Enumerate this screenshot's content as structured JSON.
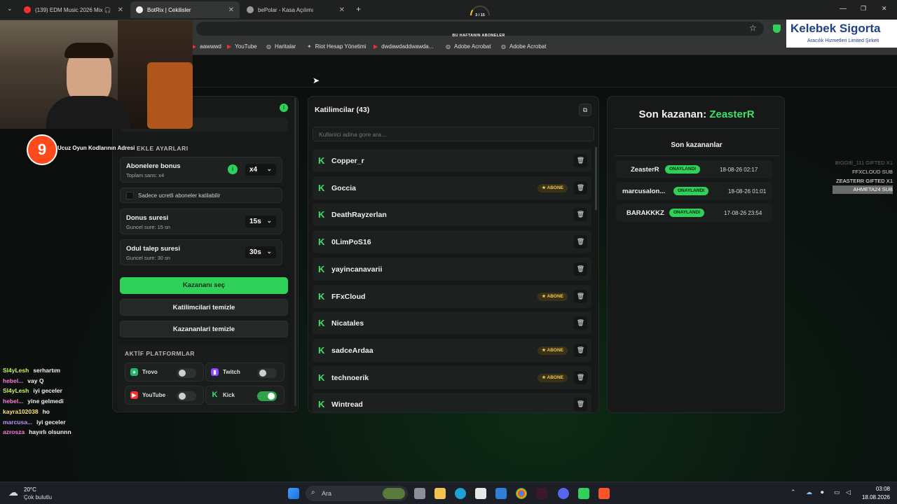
{
  "browser": {
    "tabs": [
      {
        "label": "(139) EDM Music 2026 Mix 🎧",
        "active": false
      },
      {
        "label": "BotRix | Cekilisler",
        "active": true
      },
      {
        "label": "bePolar - Kasa Açılımı",
        "active": false
      }
    ],
    "new_tab": "+",
    "window_controls": {
      "minimize": "—",
      "maximize": "❐",
      "close": "✕"
    },
    "bookmarks": [
      "aawwwd",
      "YouTube",
      "Haritalar",
      "Riot Hesap Yönetimi",
      "dwdawdaddwawda...",
      "Adobe Acrobat",
      "Adobe Acrobat"
    ]
  },
  "overlay": {
    "progress": "3 / 15",
    "progress_value": 0.2,
    "sub_banner": "BU HAFTANIN ABONELER",
    "sponsor_title": "Kelebek Sigorta",
    "sponsor_sub": "Aracılık Hizmetleri Limited Şirketi",
    "promo": "Ucuz Oyun Kodlarının Adresi",
    "right_list": [
      "BIGGIE_111  GIFTED X1",
      "FFXCLOUD  SUB",
      "ZEASTERR  GIFTED X1",
      "AHMETA24  SUB"
    ]
  },
  "settings": {
    "section_title": "EKLE AYARLARI",
    "bonus": {
      "title": "Abonelere bonus",
      "sub": "Toplam sans: x4",
      "value": "x4"
    },
    "paid_only": "Sadece ucretli aboneler katilabilir",
    "donus": {
      "title": "Donus suresi",
      "sub": "Guncel sure: 15 sn",
      "value": "15s"
    },
    "odul": {
      "title": "Odul talep suresi",
      "sub": "Guncel sure: 30 sn",
      "value": "30s"
    },
    "btn_pick": "Kazananı seç",
    "btn_clear_participants": "Katilimcilari temizle",
    "btn_clear_winners": "Kazananlari temizle",
    "platforms_title": "AKTİF PLATFORMLAR",
    "platforms": [
      {
        "name": "Trovo",
        "on": false,
        "color": "#1fb86a"
      },
      {
        "name": "Twitch",
        "on": false,
        "color": "#9146ff"
      },
      {
        "name": "YouTube",
        "on": false,
        "color": "#ff2d2d"
      },
      {
        "name": "Kick",
        "on": true,
        "color": "#3ee06a"
      }
    ]
  },
  "participants": {
    "title": "Katilimcilar (43)",
    "search_placeholder": "Kullanici adina gore ara...",
    "badge": "ABONE",
    "list": [
      {
        "name": "Copper_r",
        "abone": false
      },
      {
        "name": "Goccia",
        "abone": true
      },
      {
        "name": "DeathRayzerlan",
        "abone": false
      },
      {
        "name": "0LimPoS16",
        "abone": false
      },
      {
        "name": "yayincanavarii",
        "abone": false
      },
      {
        "name": "FFxCloud",
        "abone": true
      },
      {
        "name": "Nicatales",
        "abone": false
      },
      {
        "name": "sadceArdaa",
        "abone": true
      },
      {
        "name": "technoerik",
        "abone": true
      },
      {
        "name": "Wintread",
        "abone": false
      }
    ]
  },
  "winners": {
    "last_label": "Son kazanan:",
    "last_name": "ZeasterR",
    "list_title": "Son kazananlar",
    "status": "ONAYLANDI",
    "list": [
      {
        "name": "ZeasterR",
        "date": "18-08-26 02:17"
      },
      {
        "name": "marcusalon...",
        "date": "18-08-26 01:01"
      },
      {
        "name": "BARAKKKZ",
        "date": "17-08-26 23:54"
      }
    ]
  },
  "chat": [
    {
      "user": "Sl4yLesh",
      "msg": "serhartım",
      "color": "#c6f55b"
    },
    {
      "user": "hebel...",
      "msg": "vay Q",
      "color": "#ff7ad9"
    },
    {
      "user": "Sl4yLesh",
      "msg": "iyi geceler",
      "color": "#c6f55b"
    },
    {
      "user": "hebel...",
      "msg": "yine gelmedi",
      "color": "#ff7ad9"
    },
    {
      "user": "kayra102038",
      "msg": "ho",
      "color": "#ffe66b"
    },
    {
      "user": "marcusa...",
      "msg": "iyi geceler",
      "color": "#c68cff"
    },
    {
      "user": "azrosza",
      "msg": "hayırlı olsunnn",
      "color": "#ff7ad9"
    }
  ],
  "taskbar": {
    "weather_temp": "20°C",
    "weather_desc": "Çok bulutlu",
    "search": "Ara",
    "time": "03:08",
    "date": "18.08.2026"
  }
}
